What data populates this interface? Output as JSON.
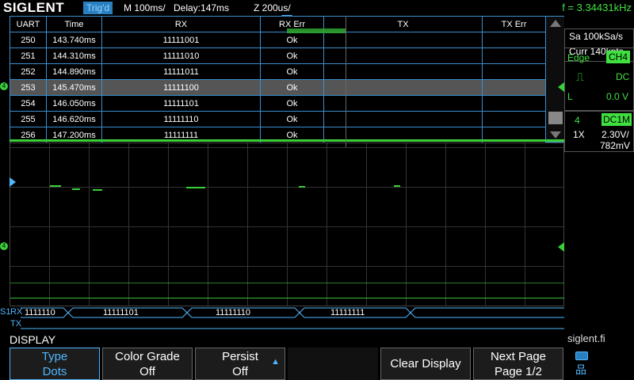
{
  "topbar": {
    "brand": "SIGLENT",
    "trig_status": "Trig'd",
    "timebase": "M 100ms/",
    "delay": "Delay:147ms",
    "zoom": "Z 200us/",
    "frequency": "f = 3.34431kHz"
  },
  "decode_table": {
    "headers": [
      "UART",
      "Time",
      "RX",
      "RX Err",
      "TX",
      "TX Err"
    ],
    "rows": [
      {
        "uart": "250",
        "time": "143.740ms",
        "rx": "11111001",
        "rx_err": "Ok",
        "tx": "",
        "tx_err": ""
      },
      {
        "uart": "251",
        "time": "144.310ms",
        "rx": "11111010",
        "rx_err": "Ok",
        "tx": "",
        "tx_err": ""
      },
      {
        "uart": "252",
        "time": "144.890ms",
        "rx": "11111011",
        "rx_err": "Ok",
        "tx": "",
        "tx_err": ""
      },
      {
        "uart": "253",
        "time": "145.470ms",
        "rx": "11111100",
        "rx_err": "Ok",
        "tx": "",
        "tx_err": ""
      },
      {
        "uart": "254",
        "time": "146.050ms",
        "rx": "11111101",
        "rx_err": "Ok",
        "tx": "",
        "tx_err": ""
      },
      {
        "uart": "255",
        "time": "146.620ms",
        "rx": "11111110",
        "rx_err": "Ok",
        "tx": "",
        "tx_err": ""
      },
      {
        "uart": "256",
        "time": "147.200ms",
        "rx": "11111111",
        "rx_err": "Ok",
        "tx": "",
        "tx_err": ""
      }
    ],
    "selected_row": 3
  },
  "bus": {
    "label_s": "S1",
    "label_rx": "RX",
    "label_tx": "TX",
    "rx_values": [
      "1111110",
      "11111101",
      "11111110",
      "11111111"
    ]
  },
  "channel_marker": "4",
  "right_panel": {
    "sample_rate": "Sa 100kSa/s",
    "memory": "Curr 140kpts",
    "trigger_type": "Edge",
    "trigger_source": "CH4",
    "trigger_coupling": "DC",
    "trigger_level_label": "L",
    "trigger_level": "0.0 V",
    "channel": "4",
    "channel_coupling": "DC1M",
    "probe": "1X",
    "volts_div": "2.30V/",
    "offset": "782mV"
  },
  "menu": {
    "title": "DISPLAY",
    "buttons": [
      {
        "line1": "Type",
        "line2": "Dots"
      },
      {
        "line1": "Color Grade",
        "line2": "Off"
      },
      {
        "line1": "Persist",
        "line2": "Off"
      },
      {
        "line1": "Clear Display",
        "line2": ""
      },
      {
        "line1": "Next Page",
        "line2": "Page 1/2"
      }
    ]
  },
  "site": "siglent.fi",
  "colors": {
    "accent_blue": "#4fb6ff",
    "trace_green": "#40e040",
    "table_border": "#3a8fd0"
  }
}
